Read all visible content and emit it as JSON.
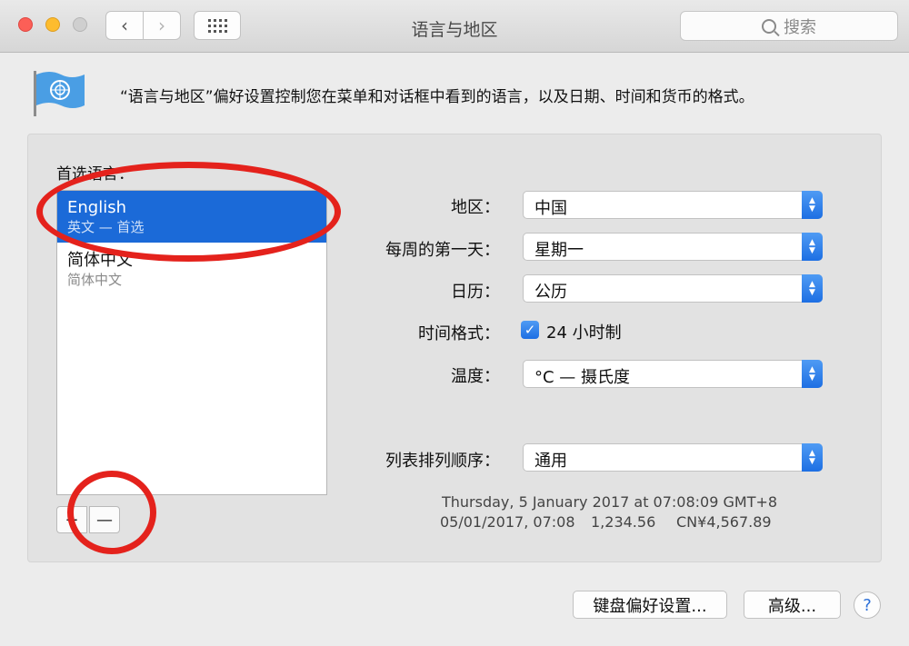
{
  "window": {
    "title": "语言与地区"
  },
  "toolbar": {
    "back_glyph": "‹",
    "forward_glyph": "›",
    "grid_icon": "grid-icon",
    "search_placeholder": "搜索"
  },
  "header": {
    "description": "“语言与地区”偏好设置控制您在菜单和对话框中看到的语言，以及日期、时间和货币的格式。"
  },
  "languages": {
    "label": "首选语言：",
    "items": [
      {
        "name": "English",
        "subtitle": "英文 — 首选"
      },
      {
        "name": "简体中文",
        "subtitle": "简体中文"
      }
    ],
    "add_label": "+",
    "remove_label": "—"
  },
  "settings": {
    "region": {
      "label": "地区：",
      "value": "中国"
    },
    "first_day": {
      "label": "每周的第一天：",
      "value": "星期一"
    },
    "calendar": {
      "label": "日历：",
      "value": "公历"
    },
    "time_format": {
      "label": "时间格式：",
      "checkbox_label": "24 小时制",
      "checked": true
    },
    "temperature": {
      "label": "温度：",
      "value": "°C — 摄氏度"
    },
    "sort_order": {
      "label": "列表排列顺序：",
      "value": "通用"
    }
  },
  "sample": {
    "line1": "Thursday, 5 January 2017 at 07:08:09 GMT+8",
    "date_short": "05/01/2017, 07:08",
    "number": "1,234.56",
    "currency": "CN¥4,567.89"
  },
  "footer": {
    "keyboard_button": "键盘偏好设置...",
    "advanced_button": "高级...",
    "help_label": "?"
  },
  "colors": {
    "accent": "#1b6ad8",
    "annotation": "#e4221c"
  }
}
